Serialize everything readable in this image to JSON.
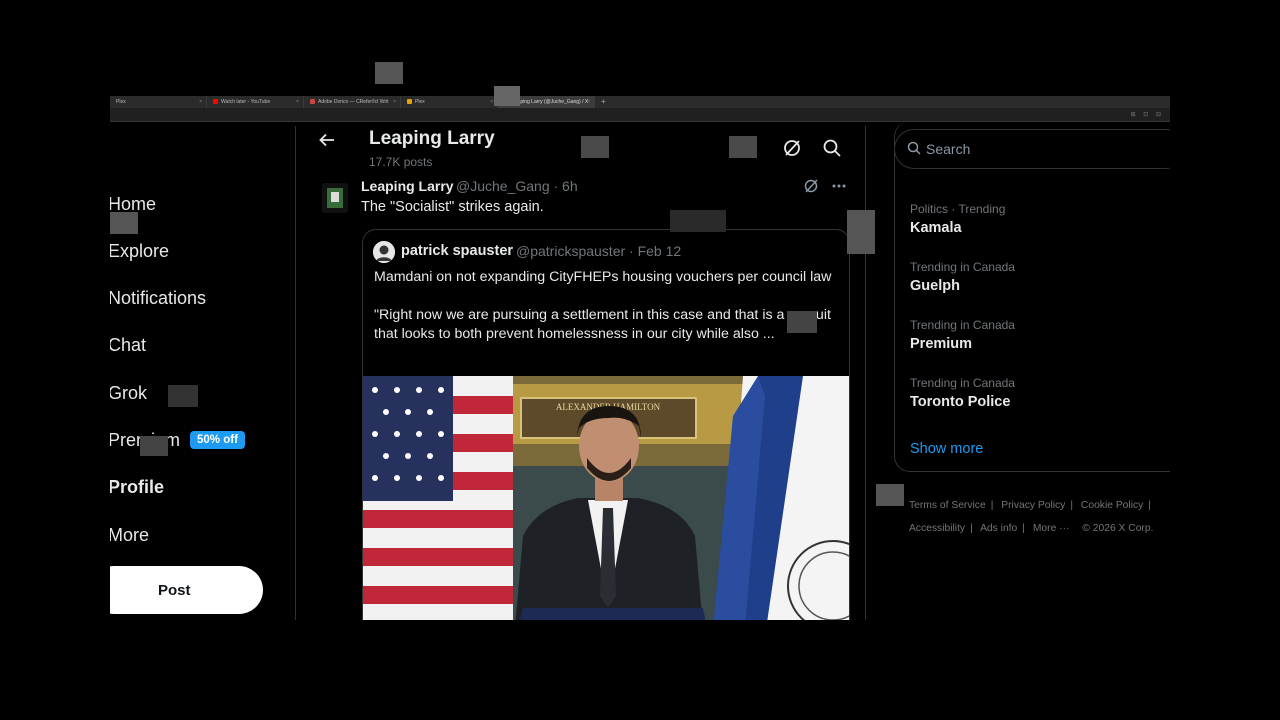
{
  "browser": {
    "tabs": [
      {
        "title": "Plex",
        "active": false
      },
      {
        "title": "Watch later - YouTube",
        "active": false
      },
      {
        "title": "Adobe Dorico — CRefer/Icl Writ",
        "active": false
      },
      {
        "title": "Plex",
        "active": false
      },
      {
        "title": "Leaping Larry (@Juche_Gang) / X",
        "active": true
      }
    ],
    "new_tab": "+"
  },
  "nav": {
    "home": "Home",
    "explore": "Explore",
    "notifications": "Notifications",
    "chat": "Chat",
    "grok": "Grok",
    "premium": "Premium",
    "premium_badge": "50% off",
    "profile": "Profile",
    "more": "More",
    "post": "Post"
  },
  "profile_header": {
    "name": "Leaping Larry",
    "post_count": "17.7K posts",
    "icons": [
      "back-arrow-icon",
      "grok-icon",
      "search-icon"
    ]
  },
  "tweet": {
    "author": "Leaping Larry",
    "handle_time": "@Juche_Gang · 6h",
    "text": "The \"Socialist\" strikes again.",
    "quote": {
      "author": "patrick spauster",
      "handle_date": "@patrickspauster · Feb 12",
      "paragraph1": "Mamdani on not expanding CityFHEPs housing vouchers per council law",
      "paragraph2": "\"Right now we are pursuing a settlement in this case and that is a pursuit that looks to both prevent homelessness in our city while also ...",
      "image_placard": "ALEXANDER HAMILTON"
    }
  },
  "sidebar": {
    "search_placeholder": "Search",
    "trends": [
      {
        "meta": "Politics · Trending",
        "name": "Kamala"
      },
      {
        "meta": "Trending in Canada",
        "name": "Guelph"
      },
      {
        "meta": "Trending in Canada",
        "name": "Premium"
      },
      {
        "meta": "Trending in Canada",
        "name": "Toronto Police"
      }
    ],
    "show_more": "Show more",
    "footer": {
      "terms": "Terms of Service",
      "privacy": "Privacy Policy",
      "cookie": "Cookie Policy",
      "accessibility": "Accessibility",
      "ads": "Ads info",
      "more": "More ···",
      "copyright": "© 2026 X Corp."
    }
  },
  "colors": {
    "background": "#000000",
    "accent": "#1d9bf0",
    "text": "#e7e9ea",
    "muted": "#71767b",
    "border": "#2f3336"
  }
}
